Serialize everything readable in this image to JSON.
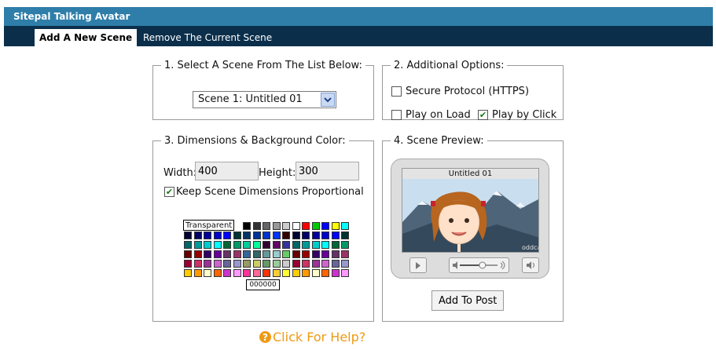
{
  "window": {
    "title": "Sitepal Talking Avatar"
  },
  "tabs": [
    {
      "label": "Add A New Scene",
      "active": true
    },
    {
      "label": "Remove The Current Scene",
      "active": false
    }
  ],
  "section1": {
    "legend": "1. Select A Scene From The List Below:",
    "scene_select": {
      "value": "Scene 1: Untitled 01"
    }
  },
  "section2": {
    "legend": "2. Additional Options:",
    "secure_protocol": {
      "label": "Secure Protocol (HTTPS)",
      "checked": false
    },
    "play_on_load": {
      "label": "Play on Load",
      "checked": false
    },
    "play_by_click": {
      "label": "Play by Click",
      "checked": true
    }
  },
  "section3": {
    "legend": "3. Dimensions & Background Color:",
    "width_label": "Width:",
    "width_value": "400",
    "height_label": "Height:",
    "height_value": "300",
    "keep_proportional": {
      "label": "Keep Scene Dimensions Proportional",
      "checked": true
    },
    "transparent_label": "Transparent",
    "color_hex": "000000",
    "palette": [
      [
        "#000000",
        "#333333",
        "#666666",
        "#999999",
        "#cccccc",
        "#ffffff",
        "#ff0000",
        "#00cc00",
        "#0000ff",
        "#ffff00",
        "#00ffff"
      ],
      [
        "#000033",
        "#000066",
        "#000099",
        "#0000cc",
        "#0000ff",
        "#003333",
        "#003366",
        "#003399",
        "#0033cc",
        "#0033ff",
        "#330000"
      ],
      [
        "#006666",
        "#009999",
        "#00cccc",
        "#00ffff",
        "#006633",
        "#009966",
        "#00cc99",
        "#00ff99",
        "#330033",
        "#660066",
        "#333399"
      ],
      [
        "#660000",
        "#990000",
        "#330066",
        "#660099",
        "#663366",
        "#993366",
        "#336699",
        "#336666",
        "#669999",
        "#99cccc",
        "#66cc66"
      ],
      [
        "#990033",
        "#cc3366",
        "#993399",
        "#cc66cc",
        "#666699",
        "#9999cc",
        "#999966",
        "#cccc66",
        "#669966",
        "#99cc99",
        "#cccccc"
      ],
      [
        "#ffcc00",
        "#ff9900",
        "#ffffcc",
        "#ff6600",
        "#cc33cc",
        "#ff99ff",
        "#ff3399",
        "#ff6699",
        "#ff3300",
        "#ffcc33",
        "#ffff33"
      ]
    ]
  },
  "section4": {
    "legend": "4. Scene Preview:",
    "preview_caption": "Untitled 01",
    "watermark": "oddcast",
    "volume_level": 0.6,
    "add_button": "Add To Post"
  },
  "help": {
    "label": "Click For Help?"
  },
  "colors": {
    "titlebar": "#2e7ea9",
    "tabbar": "#0b2f4b",
    "help": "#ee9a13"
  }
}
